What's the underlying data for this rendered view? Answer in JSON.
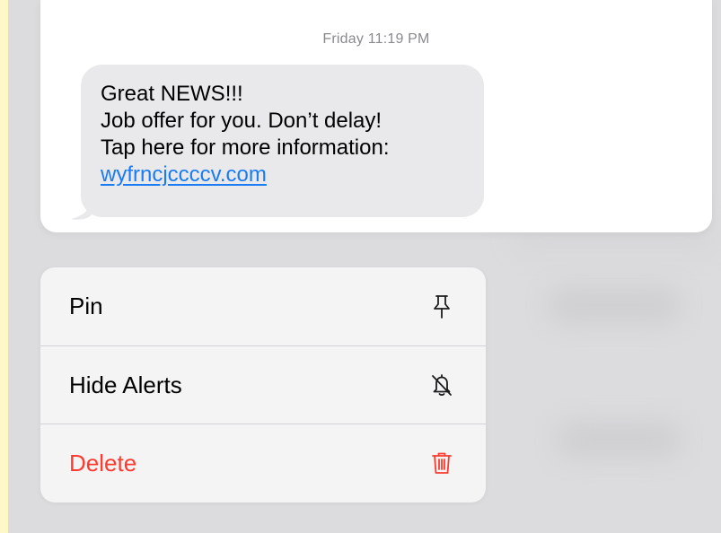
{
  "message": {
    "timestamp": "Friday 11:19 PM",
    "lines": [
      "Great NEWS!!!",
      "Job offer for you. Don’t delay!",
      "Tap here for more information:"
    ],
    "link_text": "wyfrncjccccv.com"
  },
  "context_menu": {
    "items": [
      {
        "label": "Pin",
        "icon": "pin-icon"
      },
      {
        "label": "Hide Alerts",
        "icon": "bell-slash-icon"
      },
      {
        "label": "Delete",
        "icon": "trash-icon"
      }
    ]
  },
  "colors": {
    "frame": "#fdf8c8",
    "link": "#1a7cf5",
    "destructive": "#ff3b30",
    "bubble": "#e9e9eb"
  }
}
